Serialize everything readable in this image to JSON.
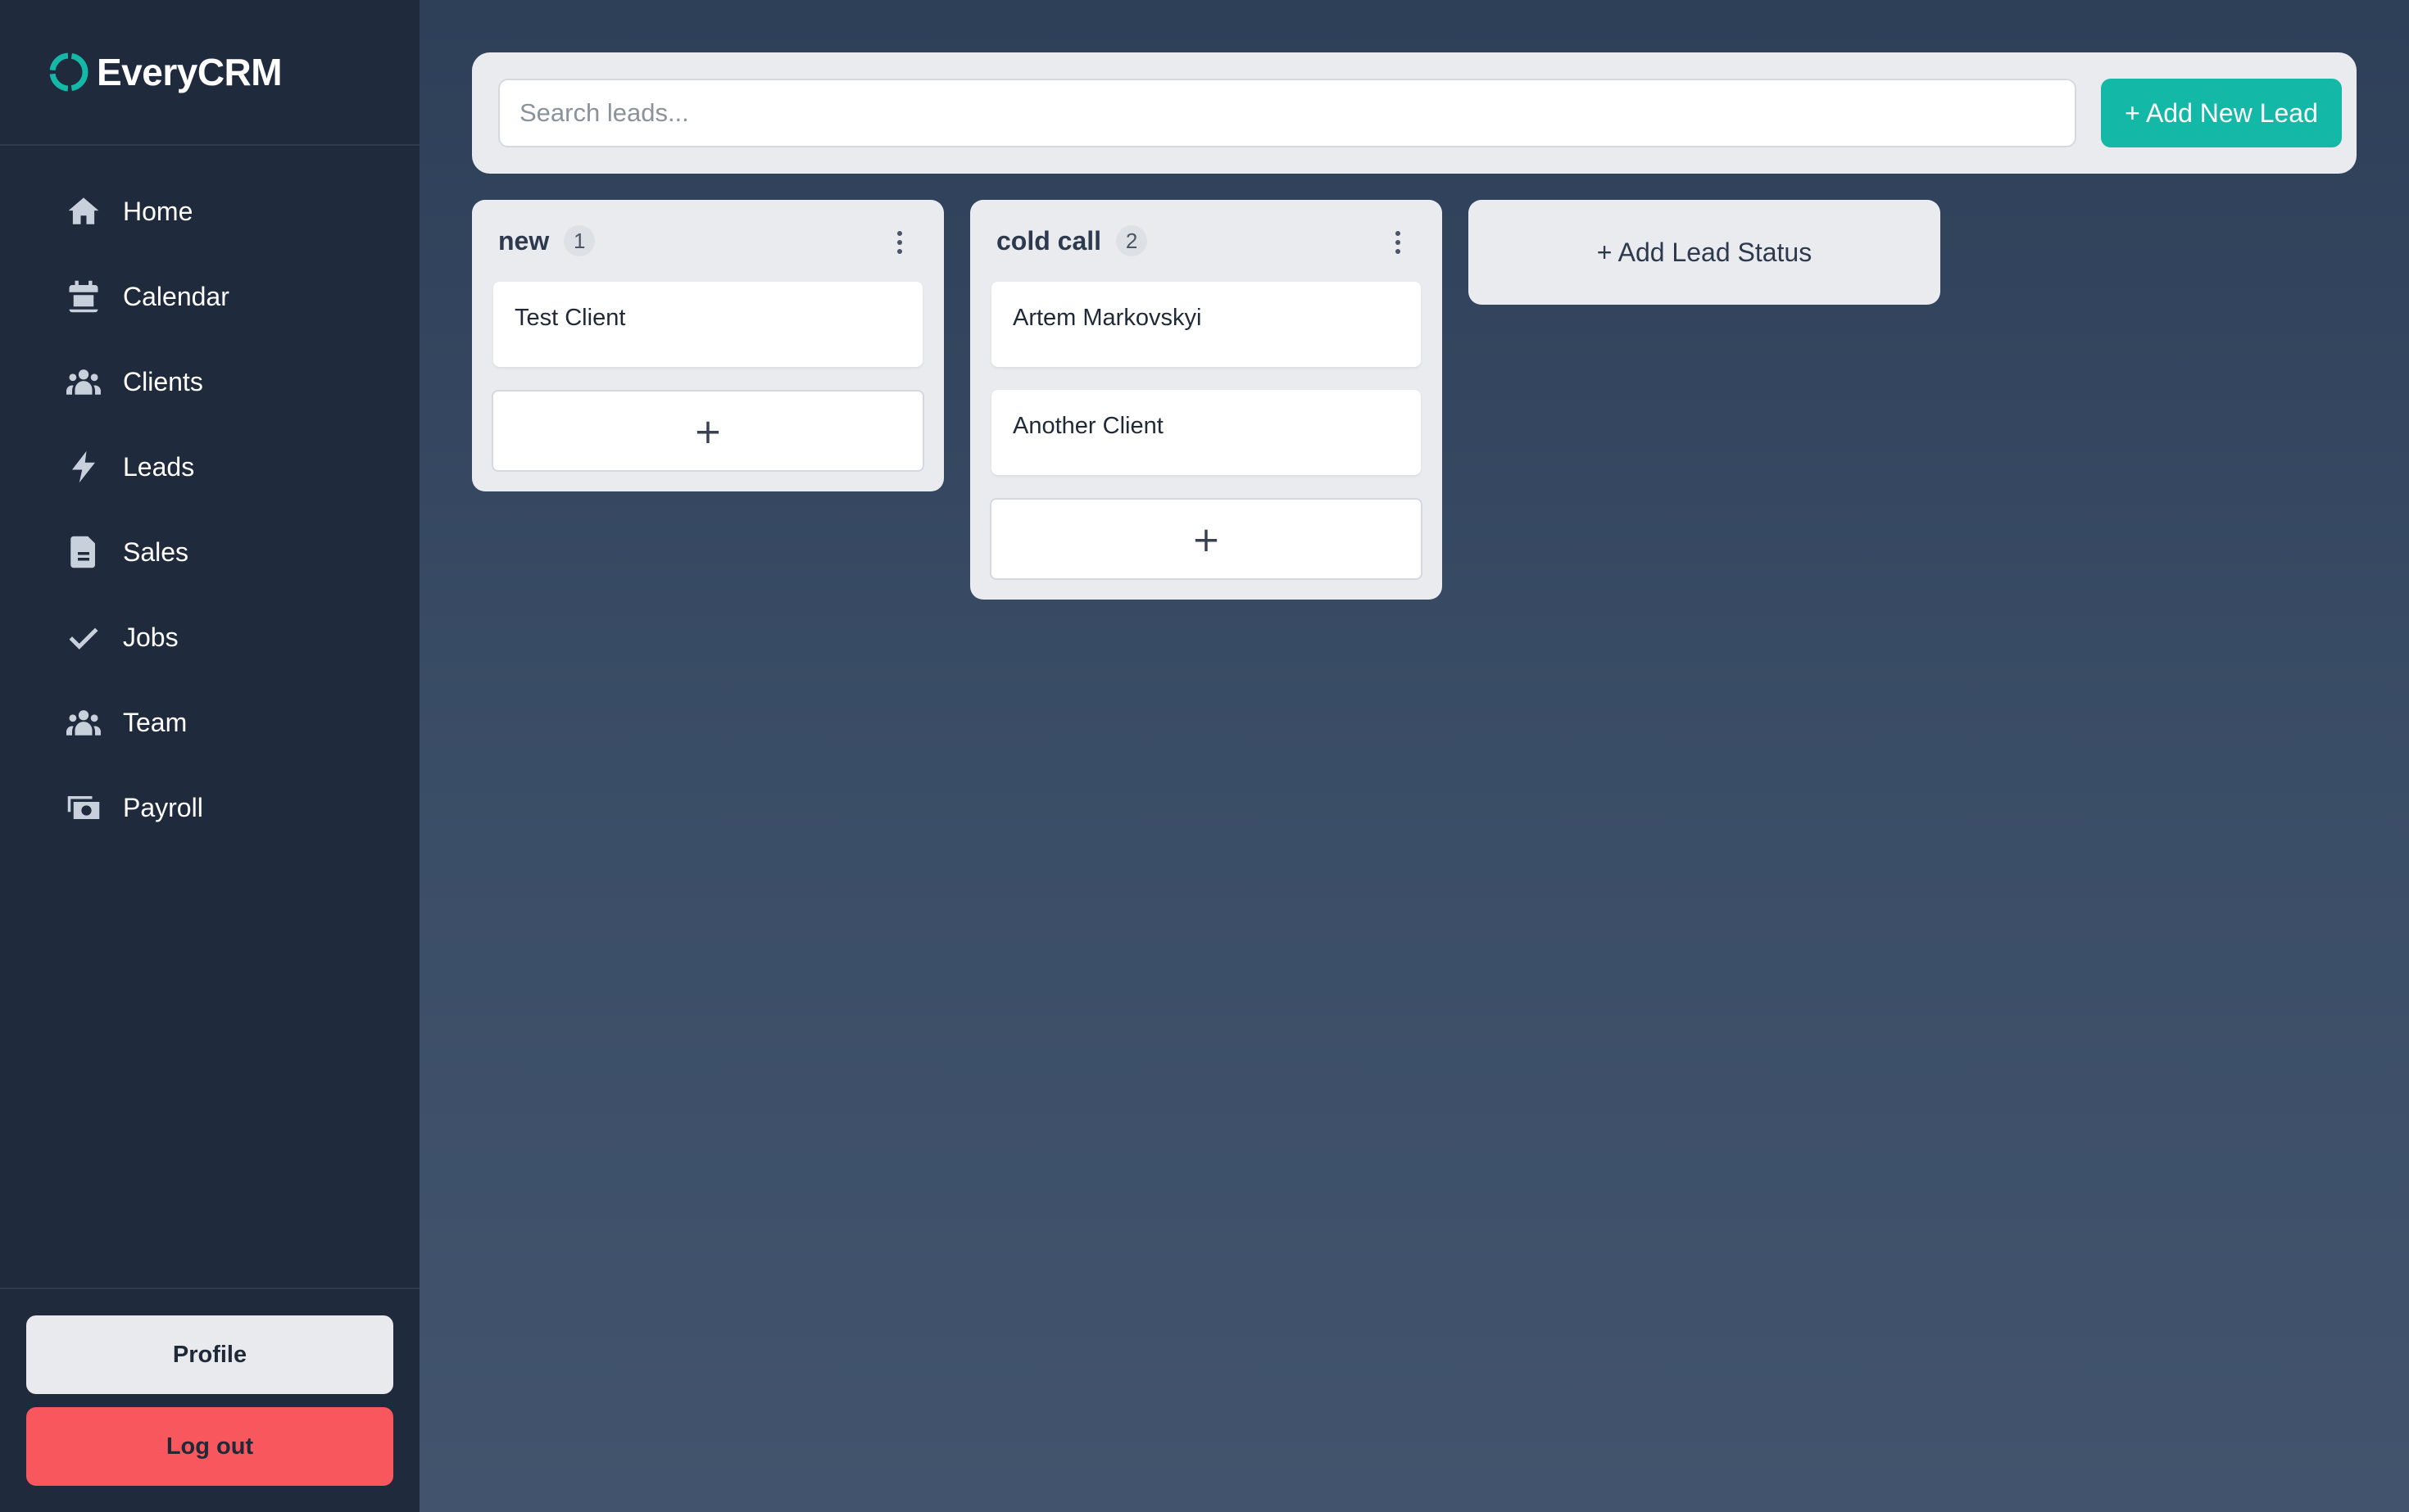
{
  "app": {
    "name": "EveryCRM",
    "accent_color": "#14b8a6"
  },
  "sidebar": {
    "items": [
      {
        "label": "Home",
        "icon": "home-icon"
      },
      {
        "label": "Calendar",
        "icon": "calendar-icon"
      },
      {
        "label": "Clients",
        "icon": "users-icon"
      },
      {
        "label": "Leads",
        "icon": "bolt-icon"
      },
      {
        "label": "Sales",
        "icon": "document-icon"
      },
      {
        "label": "Jobs",
        "icon": "check-icon"
      },
      {
        "label": "Team",
        "icon": "users-icon"
      },
      {
        "label": "Payroll",
        "icon": "money-icon"
      }
    ],
    "profile_label": "Profile",
    "logout_label": "Log out",
    "logout_color": "#f9575e"
  },
  "toolbar": {
    "search_placeholder": "Search leads...",
    "search_value": "",
    "add_lead_label": "+ Add New Lead"
  },
  "board": {
    "columns": [
      {
        "title": "new",
        "count": "1",
        "cards": [
          "Test Client"
        ],
        "add_label": "+"
      },
      {
        "title": "cold call",
        "count": "2",
        "cards": [
          "Artem Markovskyi",
          "Another Client"
        ],
        "add_label": "+"
      }
    ],
    "add_status_label": "+ Add Lead Status"
  }
}
